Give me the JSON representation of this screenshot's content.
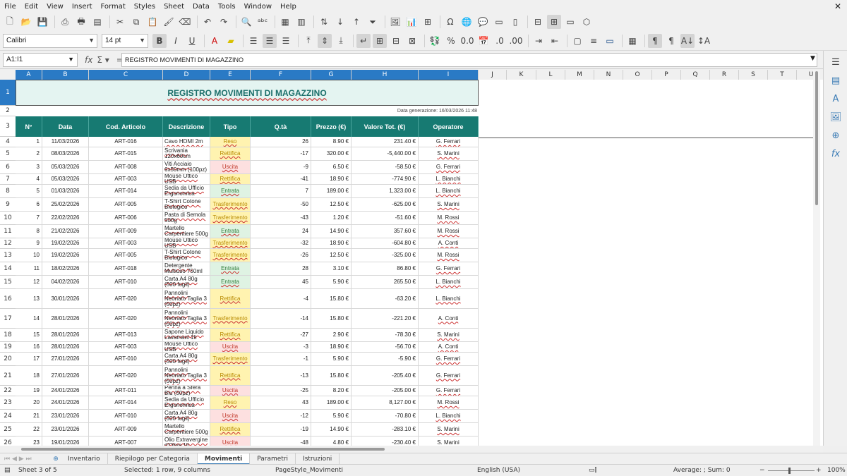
{
  "menu": [
    "File",
    "Edit",
    "View",
    "Insert",
    "Format",
    "Styles",
    "Sheet",
    "Data",
    "Tools",
    "Window",
    "Help"
  ],
  "font": {
    "name": "Calibri",
    "size": "14 pt"
  },
  "namebox": "A1:I1",
  "formula": "REGISTRO MOVIMENTI DI MAGAZZINO",
  "columns": [
    "A",
    "B",
    "C",
    "D",
    "E",
    "F",
    "G",
    "H",
    "I",
    "J",
    "K",
    "L",
    "M",
    "N",
    "O",
    "P",
    "Q",
    "R",
    "S",
    "T",
    "U"
  ],
  "title": "REGISTRO MOVIMENTI DI MAGAZZINO",
  "generated": "Data generazione: 16/03/2026 11:48",
  "headers": [
    "N°",
    "Data",
    "Cod. Articolo",
    "Descrizione",
    "Tipo",
    "Q.tà",
    "Prezzo (€)",
    "Valore Tot. (€)",
    "Operatore"
  ],
  "rows": [
    {
      "n": "1",
      "date": "11/03/2026",
      "code": "ART-016",
      "desc": "Cavo HDMI 2m",
      "tipo": "Reso",
      "qty": "26",
      "price": "8.90 €",
      "total": "231.40 €",
      "op": "G. Ferrari"
    },
    {
      "n": "2",
      "date": "08/03/2026",
      "code": "ART-015",
      "desc": "Scrivania 120x60cm",
      "tipo": "Rettifica",
      "qty": "-17",
      "price": "320.00 €",
      "total": "-5,440.00 €",
      "op": "S. Marini"
    },
    {
      "n": "3",
      "date": "05/03/2026",
      "code": "ART-008",
      "desc": "Viti Acciaio 6x50mm (100pz)",
      "tipo": "Uscita",
      "qty": "-9",
      "price": "6.50 €",
      "total": "-58.50 €",
      "op": "G. Ferrari"
    },
    {
      "n": "4",
      "date": "05/03/2026",
      "code": "ART-003",
      "desc": "Mouse Ottico USB",
      "tipo": "Rettifica",
      "qty": "-41",
      "price": "18.90 €",
      "total": "-774.90 €",
      "op": "L. Bianchi"
    },
    {
      "n": "5",
      "date": "01/03/2026",
      "code": "ART-014",
      "desc": "Sedia da Ufficio Ergonomica",
      "tipo": "Entrata",
      "qty": "7",
      "price": "189.00 €",
      "total": "1,323.00 €",
      "op": "L. Bianchi"
    },
    {
      "n": "6",
      "date": "25/02/2026",
      "code": "ART-005",
      "desc": "T-Shirt Cotone Biologico",
      "tipo": "Trasferimento",
      "qty": "-50",
      "price": "12.50 €",
      "total": "-625.00 €",
      "op": "S. Marini"
    },
    {
      "n": "7",
      "date": "22/02/2026",
      "code": "ART-006",
      "desc": "Pasta di Semola 500g",
      "tipo": "Trasferimento",
      "qty": "-43",
      "price": "1.20 €",
      "total": "-51.60 €",
      "op": "M. Rossi"
    },
    {
      "n": "8",
      "date": "21/02/2026",
      "code": "ART-009",
      "desc": "Martello Carpentiere 500g",
      "tipo": "Entrata",
      "qty": "24",
      "price": "14.90 €",
      "total": "357.60 €",
      "op": "M. Rossi"
    },
    {
      "n": "9",
      "date": "19/02/2026",
      "code": "ART-003",
      "desc": "Mouse Ottico USB",
      "tipo": "Trasferimento",
      "qty": "-32",
      "price": "18.90 €",
      "total": "-604.80 €",
      "op": "A. Conti"
    },
    {
      "n": "10",
      "date": "19/02/2026",
      "code": "ART-005",
      "desc": "T-Shirt Cotone Biologico",
      "tipo": "Trasferimento",
      "qty": "-26",
      "price": "12.50 €",
      "total": "-325.00 €",
      "op": "M. Rossi"
    },
    {
      "n": "11",
      "date": "18/02/2026",
      "code": "ART-018",
      "desc": "Detergente Multiuso 750ml",
      "tipo": "Entrata",
      "qty": "28",
      "price": "3.10 €",
      "total": "86.80 €",
      "op": "G. Ferrari"
    },
    {
      "n": "12",
      "date": "04/02/2026",
      "code": "ART-010",
      "desc": "Carta A4 80g (500 fogli)",
      "tipo": "Entrata",
      "qty": "45",
      "price": "5.90 €",
      "total": "265.50 €",
      "op": "L. Bianchi"
    },
    {
      "n": "13",
      "date": "30/01/2026",
      "code": "ART-020",
      "desc": "Pannolini Neonato Taglia 3 (50pz)",
      "tipo": "Rettifica",
      "qty": "-4",
      "price": "15.80 €",
      "total": "-63.20 €",
      "op": "L. Bianchi"
    },
    {
      "n": "14",
      "date": "28/01/2026",
      "code": "ART-020",
      "desc": "Pannolini Neonato Taglia 3 (50pz)",
      "tipo": "Trasferimento",
      "qty": "-14",
      "price": "15.80 €",
      "total": "-221.20 €",
      "op": "A. Conti"
    },
    {
      "n": "15",
      "date": "28/01/2026",
      "code": "ART-013",
      "desc": "Sapone Liquido Lavamani 1lt",
      "tipo": "Rettifica",
      "qty": "-27",
      "price": "2.90 €",
      "total": "-78.30 €",
      "op": "S. Marini"
    },
    {
      "n": "16",
      "date": "28/01/2026",
      "code": "ART-003",
      "desc": "Mouse Ottico USB",
      "tipo": "Uscita",
      "qty": "-3",
      "price": "18.90 €",
      "total": "-56.70 €",
      "op": "A. Conti"
    },
    {
      "n": "17",
      "date": "27/01/2026",
      "code": "ART-010",
      "desc": "Carta A4 80g (500 fogli)",
      "tipo": "Trasferimento",
      "qty": "-1",
      "price": "5.90 €",
      "total": "-5.90 €",
      "op": "G. Ferrari"
    },
    {
      "n": "18",
      "date": "27/01/2026",
      "code": "ART-020",
      "desc": "Pannolini Neonato Taglia 3 (50pz)",
      "tipo": "Rettifica",
      "qty": "-13",
      "price": "15.80 €",
      "total": "-205.40 €",
      "op": "G. Ferrari"
    },
    {
      "n": "19",
      "date": "24/01/2026",
      "code": "ART-011",
      "desc": "Penna a Sfera Blu (50pz)",
      "tipo": "Uscita",
      "qty": "-25",
      "price": "8.20 €",
      "total": "-205.00 €",
      "op": "G. Ferrari"
    },
    {
      "n": "20",
      "date": "24/01/2026",
      "code": "ART-014",
      "desc": "Sedia da Ufficio Ergonomica",
      "tipo": "Reso",
      "qty": "43",
      "price": "189.00 €",
      "total": "8,127.00 €",
      "op": "M. Rossi"
    },
    {
      "n": "21",
      "date": "23/01/2026",
      "code": "ART-010",
      "desc": "Carta A4 80g (500 fogli)",
      "tipo": "Uscita",
      "qty": "-12",
      "price": "5.90 €",
      "total": "-70.80 €",
      "op": "L. Bianchi"
    },
    {
      "n": "22",
      "date": "23/01/2026",
      "code": "ART-009",
      "desc": "Martello Carpentiere 500g",
      "tipo": "Rettifica",
      "qty": "-19",
      "price": "14.90 €",
      "total": "-283.10 €",
      "op": "S. Marini"
    },
    {
      "n": "23",
      "date": "19/01/2026",
      "code": "ART-007",
      "desc": "Olio Extravergine d'Oliva 1lt",
      "tipo": "Uscita",
      "qty": "-48",
      "price": "4.80 €",
      "total": "-230.40 €",
      "op": "S. Marini"
    }
  ],
  "tipo_colors": {
    "Reso": "#fff3b0",
    "Rettifica": "#fff3b0",
    "Uscita": "#fde0e0",
    "Entrata": "#dff3e3",
    "Trasferimento": "#fff3b0"
  },
  "tipo_text": {
    "Reso": "#b88a00",
    "Rettifica": "#b88a00",
    "Uscita": "#c0392b",
    "Entrata": "#2f7d3b",
    "Trasferimento": "#b88a00"
  },
  "tabs": [
    "Inventario",
    "Riepilogo per Categoria",
    "Movimenti",
    "Parametri",
    "Istruzioni"
  ],
  "active_tab": "Movimenti",
  "status": {
    "sheet": "Sheet 3 of 5",
    "selection": "Selected: 1 row, 9 columns",
    "pagestyle": "PageStyle_Movimenti",
    "lang": "English (USA)",
    "agg": "Average: ; Sum: 0",
    "zoom": "100%"
  }
}
